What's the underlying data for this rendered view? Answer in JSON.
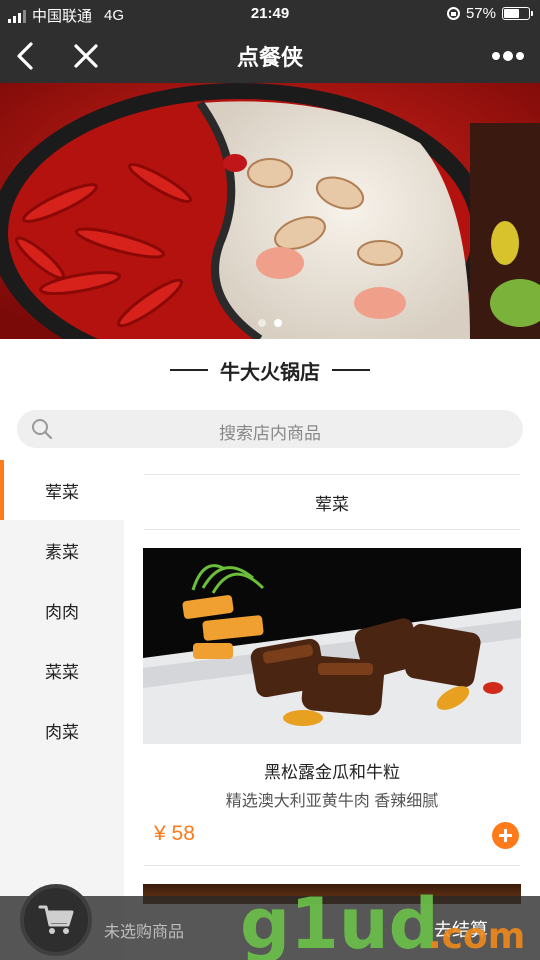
{
  "status_bar": {
    "carrier": "中国联通",
    "network": "4G",
    "time": "21:49",
    "battery": "57%",
    "battery_level": 0.57
  },
  "nav": {
    "title": "点餐侠",
    "back_icon": "chevron-left-icon",
    "close_icon": "close-icon",
    "more_icon": "more-dots-icon"
  },
  "banner": {
    "slides": 2,
    "active_slide": 1
  },
  "store": {
    "name": "牛大火锅店"
  },
  "search": {
    "placeholder": "搜索店内商品"
  },
  "sidebar": {
    "items": [
      {
        "label": "荤菜",
        "active": true
      },
      {
        "label": "素菜",
        "active": false
      },
      {
        "label": "肉肉",
        "active": false
      },
      {
        "label": "菜菜",
        "active": false
      },
      {
        "label": "肉菜",
        "active": false
      }
    ]
  },
  "content": {
    "category_title": "荤菜",
    "dishes": [
      {
        "name": "黑松露金瓜和牛粒",
        "description": "精选澳大利亚黄牛肉 香辣细腻",
        "price": "¥ 58"
      }
    ]
  },
  "cart": {
    "empty_text": "未选购商品",
    "checkout_label": "去结算"
  },
  "watermark": {
    "text": "g1ud.com"
  },
  "colors": {
    "accent": "#ff7a1a",
    "header_bg": "#2f2f2f",
    "sidebar_bg": "#f4f4f4"
  }
}
